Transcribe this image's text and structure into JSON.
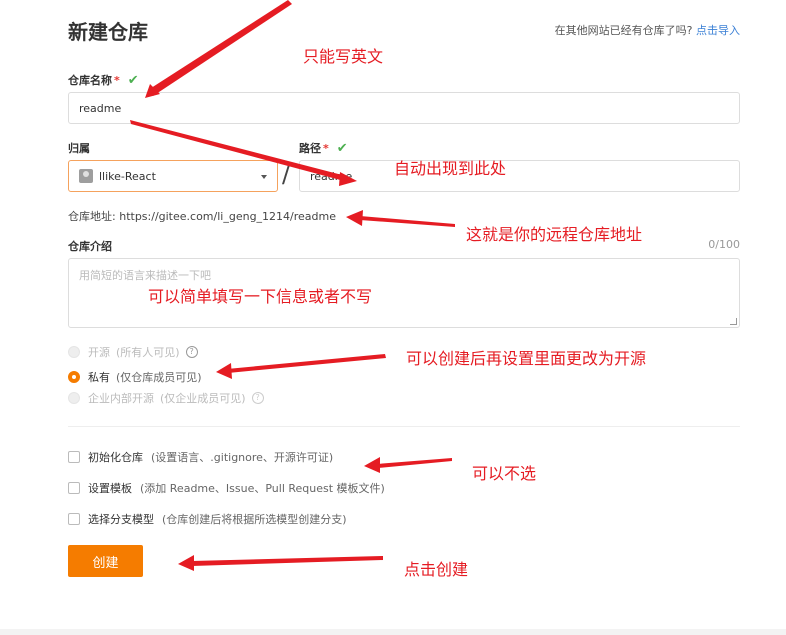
{
  "header": {
    "title": "新建仓库",
    "import_prefix": "在其他网站已经有仓库了吗?",
    "import_link": "点击导入"
  },
  "repo_name": {
    "label": "仓库名称",
    "required": "*",
    "value": "readme"
  },
  "owner": {
    "label": "归属",
    "value": "llike-React"
  },
  "path": {
    "label": "路径",
    "required": "*",
    "value": "readme"
  },
  "address": {
    "label": "仓库地址:",
    "value": "https://gitee.com/li_geng_1214/readme"
  },
  "description": {
    "label": "仓库介绍",
    "counter": "0/100",
    "placeholder": "用简短的语言来描述一下吧"
  },
  "visibility": [
    {
      "label": "开源",
      "hint": "(所有人可见)"
    },
    {
      "label": "私有",
      "hint": "(仅仓库成员可见)"
    },
    {
      "label": "企业内部开源",
      "hint": "(仅企业成员可见)"
    }
  ],
  "options": [
    {
      "label": "初始化仓库",
      "hint": "(设置语言、.gitignore、开源许可证)"
    },
    {
      "label": "设置模板",
      "hint": "(添加 Readme、Issue、Pull Request 模板文件)"
    },
    {
      "label": "选择分支模型",
      "hint": "(仓库创建后将根据所选模型创建分支)"
    }
  ],
  "create_button": "创建",
  "annotations": {
    "english_only": "只能写英文",
    "auto_appear": "自动出现到此处",
    "remote_address": "这就是你的远程仓库地址",
    "fill_simple": "可以简单填写一下信息或者不写",
    "change_open": "可以创建后再设置里面更改为开源",
    "optional": "可以不选",
    "click_create": "点击创建"
  },
  "colors": {
    "accent": "#f57c00",
    "annotation": "#e51c23",
    "link": "#3a7fd5",
    "check": "#4caf50"
  }
}
